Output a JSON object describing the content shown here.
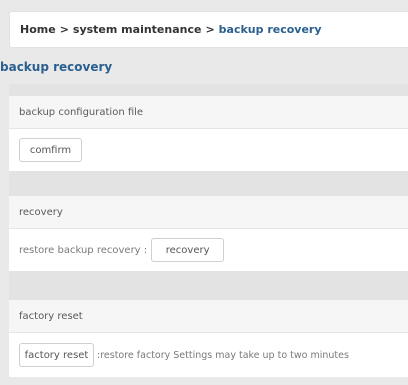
{
  "breadcrumb": {
    "home": "Home",
    "separator_1": ">",
    "section": "system maintenance",
    "separator_2": ">",
    "current": "backup recovery"
  },
  "page_title": "backup recovery",
  "backup_section": {
    "header": "backup configuration file",
    "confirm_label": "comfirm"
  },
  "recovery_section": {
    "header": "recovery",
    "label": "restore backup recovery :",
    "button_label": "recovery"
  },
  "factory_section": {
    "header": "factory reset",
    "button_label": "factory reset",
    "note": ":restore factory Settings may take up to two minutes"
  },
  "colors": {
    "accent": "#2a5f8f",
    "page_background": "#e9e9e9",
    "panel_background": "#ffffff"
  }
}
